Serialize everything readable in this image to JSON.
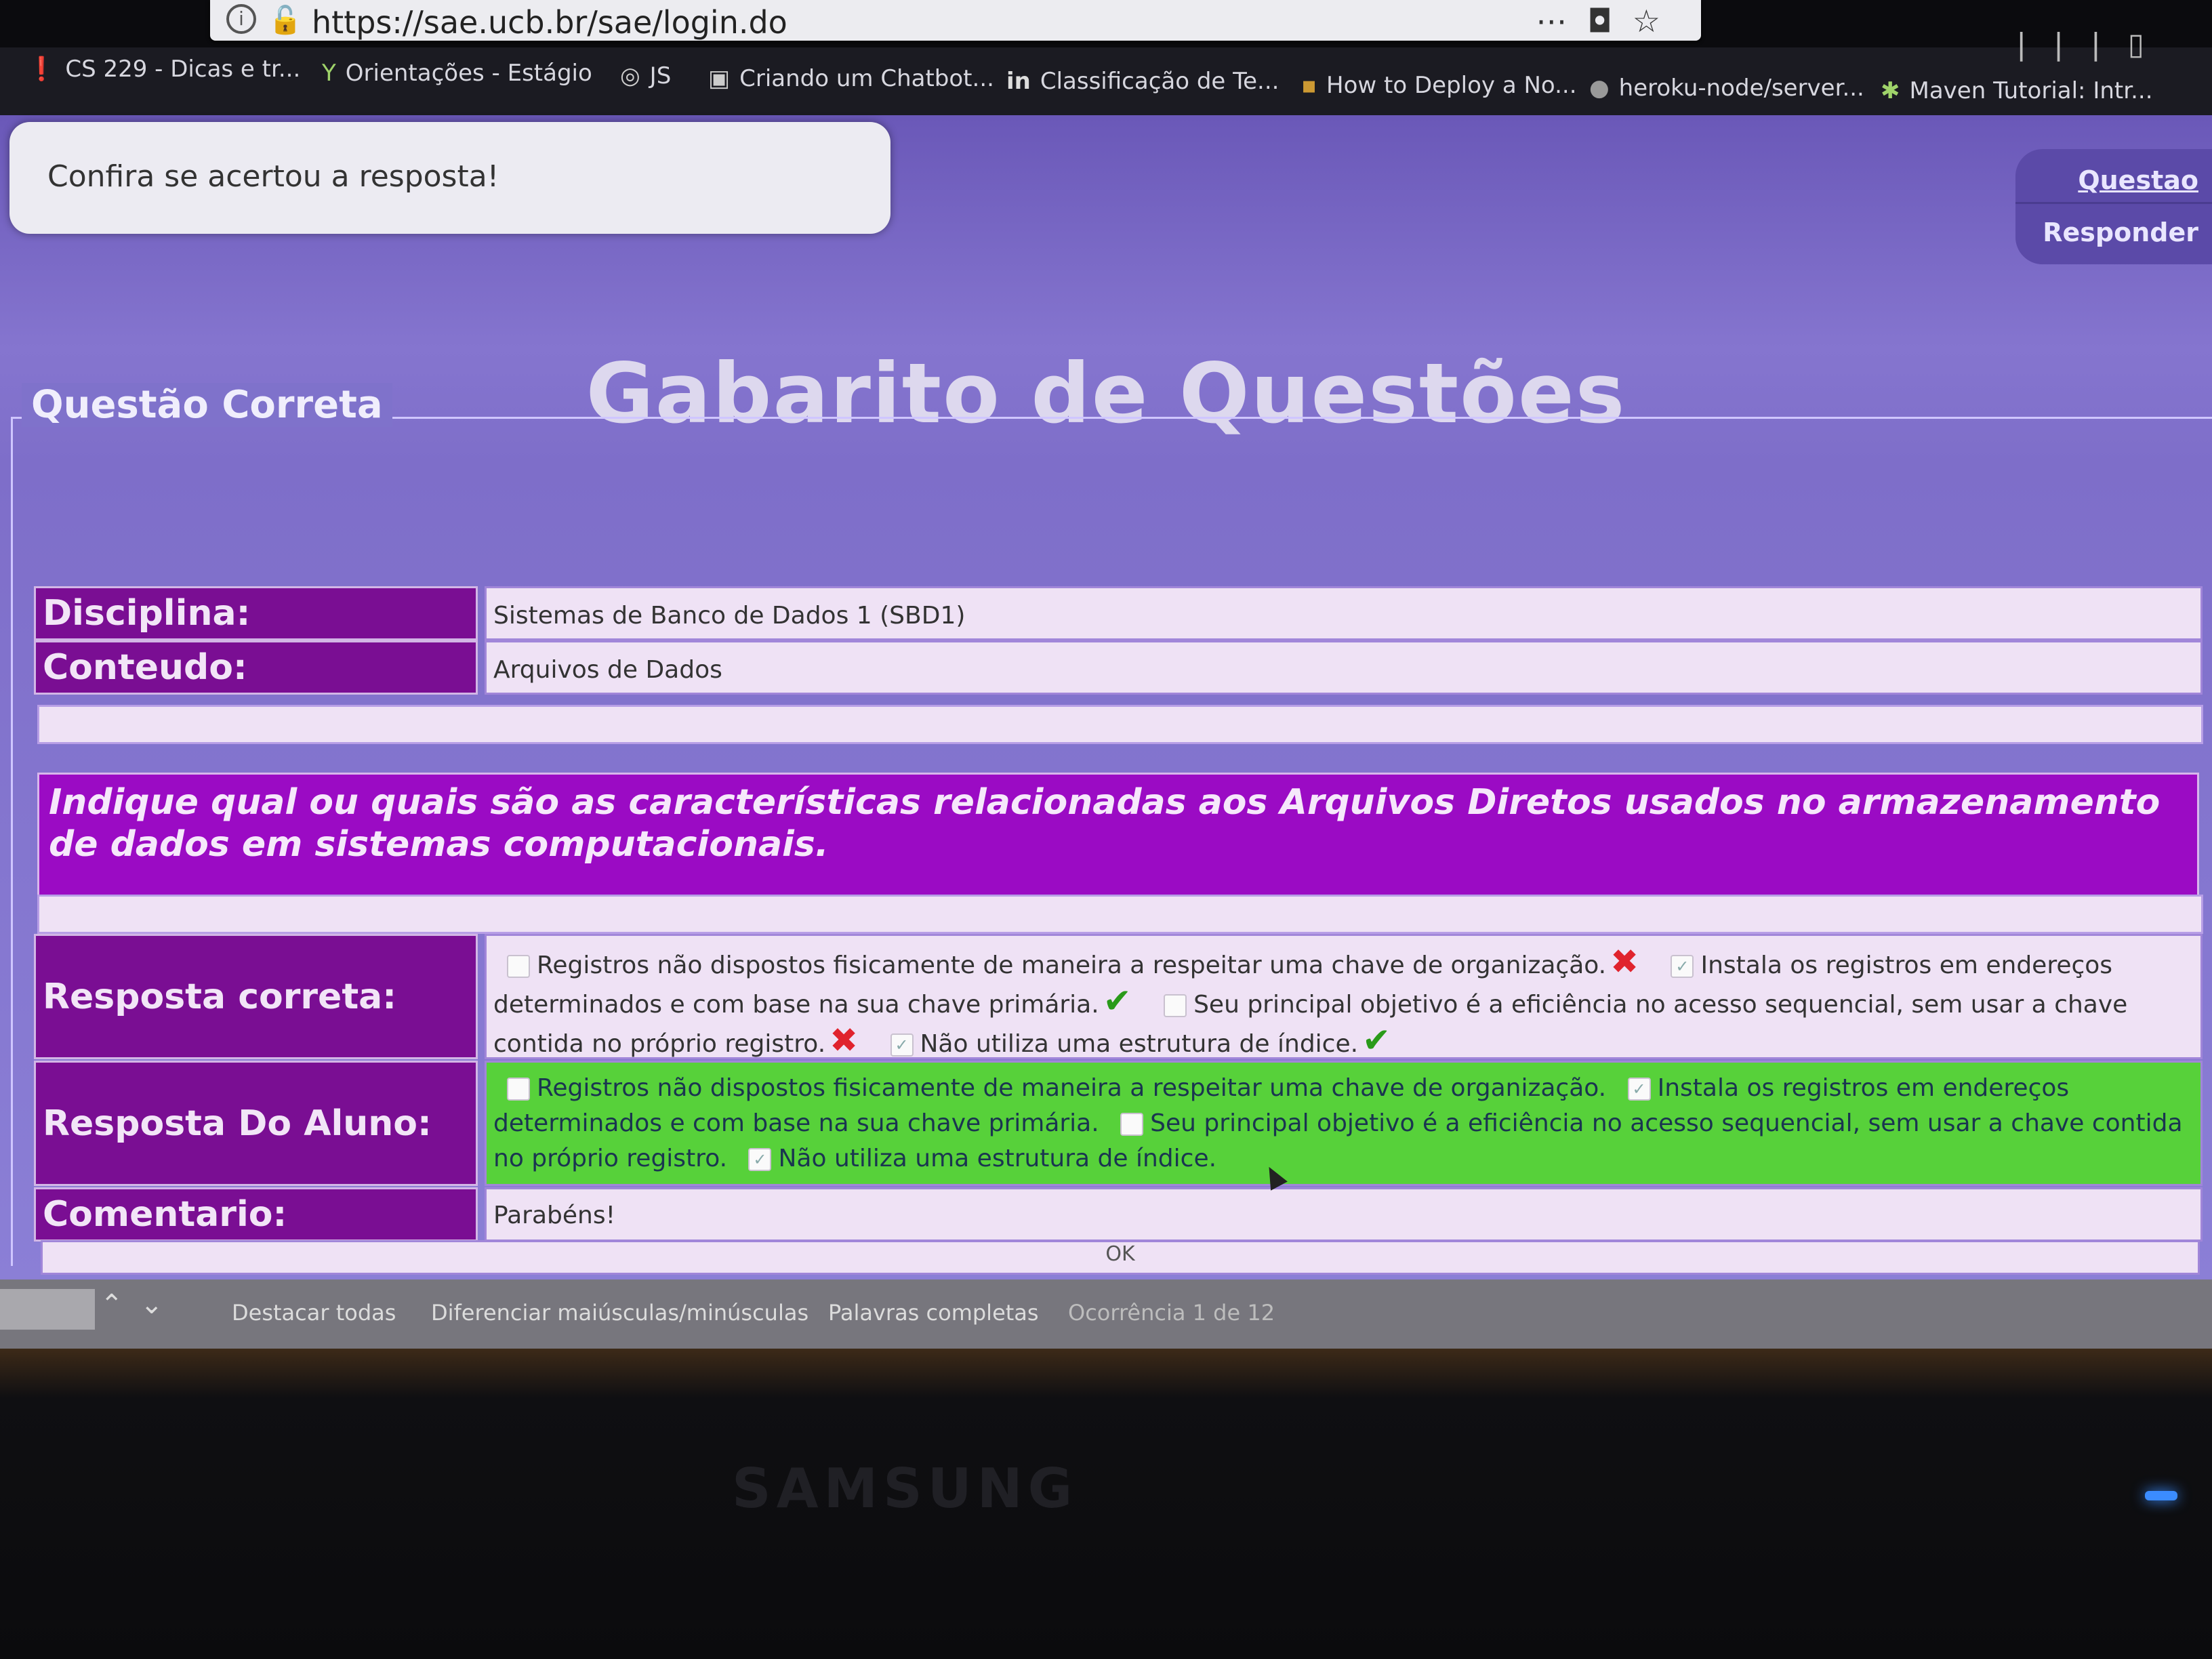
{
  "browser": {
    "url": "https://sae.ucb.br/sae/login.do",
    "bookmarks": [
      "CS 229 - Dicas e tr...",
      "Orientações - Estágio",
      "JS",
      "Criando um Chatbot...",
      "Classificação de Te...",
      "How to Deploy a No...",
      "heroku-node/server...",
      "Maven Tutorial: Intr..."
    ]
  },
  "page": {
    "notice": "Confira se acertou a resposta!",
    "nav": {
      "question": "Questao",
      "answer": "Responder"
    },
    "title": "Gabarito de Questões",
    "section_legend": "Questão Correta",
    "rows": {
      "discipline_label": "Disciplina:",
      "discipline_value": "Sistemas de Banco de Dados 1 (SBD1)",
      "content_label": "Conteudo:",
      "content_value": "Arquivos de Dados"
    },
    "question": "Indique qual ou quais são as características relacionadas aos Arquivos Diretos usados no armazenamento de dados em sistemas computacionais.",
    "correct_label": "Resposta correta:",
    "student_label": "Resposta Do Aluno:",
    "comment_label": "Comentario:",
    "comment_value": "Parabéns!",
    "options": [
      "Registros não dispostos fisicamente de maneira a respeitar uma chave de organização.",
      "Instala os registros em endereços determinados e com base na sua chave primária.",
      "Seu principal objetivo é a eficiência no acesso sequencial, sem usar a chave contida no próprio registro.",
      "Não utiliza uma estrutura de índice."
    ],
    "options_correct": [
      false,
      true,
      false,
      true
    ],
    "options_student_checked": [
      false,
      true,
      false,
      true
    ],
    "ok_label": "OK"
  },
  "findbar": {
    "highlight_all": "Destacar todas",
    "match_case": "Diferenciar maiúsculas/minúsculas",
    "whole_words": "Palavras completas",
    "occurrence": "Ocorrência 1 de 12"
  },
  "monitor": {
    "brand": "SAMSUNG"
  },
  "colors": {
    "purple": "#7a0e93",
    "green": "#57d13a"
  }
}
